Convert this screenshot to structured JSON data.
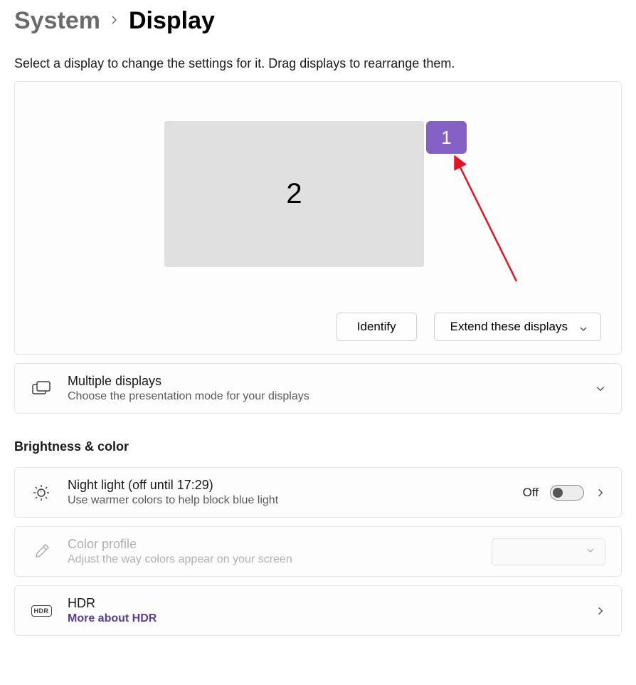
{
  "breadcrumb": {
    "parent": "System",
    "current": "Display"
  },
  "instruction": "Select a display to change the settings for it. Drag displays to rearrange them.",
  "monitors": {
    "primary_label": "1",
    "secondary_label": "2"
  },
  "arrange_footer": {
    "identify_label": "Identify",
    "mode_label": "Extend these displays"
  },
  "multiple_displays": {
    "title": "Multiple displays",
    "subtitle": "Choose the presentation mode for your displays"
  },
  "sections": {
    "brightness_color": "Brightness & color"
  },
  "night_light": {
    "title": "Night light (off until 17:29)",
    "subtitle": "Use warmer colors to help block blue light",
    "toggle_state": "Off"
  },
  "color_profile": {
    "title": "Color profile",
    "subtitle": "Adjust the way colors appear on your screen"
  },
  "hdr": {
    "title": "HDR",
    "link": "More about HDR",
    "badge": "HDR"
  }
}
